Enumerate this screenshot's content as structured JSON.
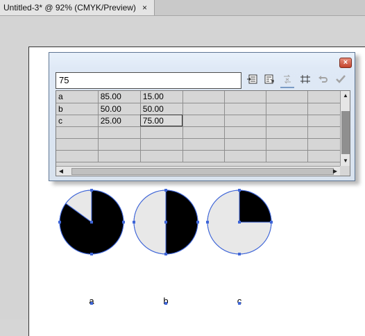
{
  "tab": {
    "title": "Untitled-3* @ 92% (CMYK/Preview)",
    "close_glyph": "×"
  },
  "graph_data_window": {
    "close_glyph": "×",
    "cell_entry_value": "75",
    "tools": [
      "import-data-icon",
      "transpose-icon",
      "switch-xy-icon",
      "cell-style-icon",
      "revert-icon",
      "apply-icon"
    ],
    "rows": [
      [
        "a",
        "85.00",
        "15.00",
        "",
        "",
        "",
        ""
      ],
      [
        "b",
        "50.00",
        "50.00",
        "",
        "",
        "",
        ""
      ],
      [
        "c",
        "25.00",
        "75.00",
        "",
        "",
        "",
        ""
      ],
      [
        "",
        "",
        "",
        "",
        "",
        "",
        ""
      ],
      [
        "",
        "",
        "",
        "",
        "",
        "",
        ""
      ],
      [
        "",
        "",
        "",
        "",
        "",
        "",
        ""
      ]
    ],
    "selected_cell": [
      2,
      2
    ]
  },
  "chart_data": {
    "type": "pie",
    "charts": [
      {
        "label": "a",
        "values": [
          85,
          15
        ]
      },
      {
        "label": "b",
        "values": [
          50,
          50
        ]
      },
      {
        "label": "c",
        "values": [
          25,
          75
        ]
      }
    ],
    "slice_colors": [
      "#000000",
      "#e8e8e8"
    ],
    "outline_color": "#3f66d8"
  }
}
